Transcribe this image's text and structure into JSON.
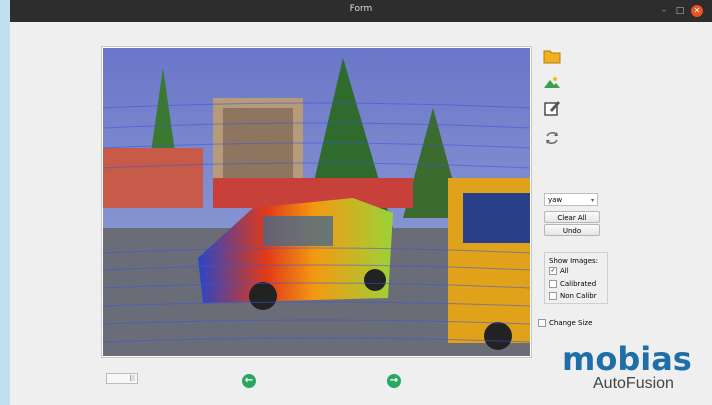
{
  "window": {
    "title": "Form",
    "minimize": "–",
    "maximize": "□",
    "close": "✕"
  },
  "toolbar": {
    "icons": [
      "folder-icon",
      "image-icon",
      "edit-icon",
      "refresh-icon"
    ]
  },
  "controls": {
    "axis_select": {
      "value": "yaw"
    },
    "clear_all": "Clear All",
    "undo": "Undo",
    "show_images": {
      "title": "Show Images:",
      "options": [
        {
          "label": "All",
          "checked": true
        },
        {
          "label": "Calibrated",
          "checked": false
        },
        {
          "label": "Non Calibr",
          "checked": false
        }
      ]
    },
    "change_size": "Change Size"
  },
  "navigation": {
    "prev": "previous-icon",
    "next": "next-icon"
  },
  "logo": {
    "brand": "mobias",
    "product": "AutoFusion",
    "color": "#1e6fa8"
  }
}
